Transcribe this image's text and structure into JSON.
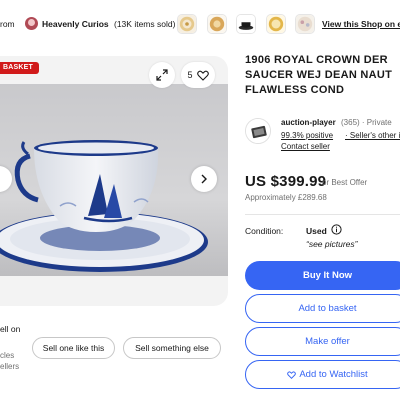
{
  "promo": {
    "from_text": "rom",
    "shop_name": "Heavenly Curios",
    "item_count": "(13K items sold)",
    "thumbnails": [
      "gold-plate-thumb",
      "amber-plate-thumb",
      "teacup-thumb",
      "gold-bowl-thumb",
      "floral-plate-thumb"
    ],
    "view_link": "View this Shop on e"
  },
  "gallery": {
    "badge": "BASKET",
    "watch_count": "5",
    "icons": [
      "expand-icon",
      "heart-icon",
      "chevron-right-icon"
    ]
  },
  "sell": {
    "sell_on": "ell on",
    "frag_cycles": "cles",
    "frag_sellers": "ellers",
    "sell_one_like_this": "Sell one like this",
    "sell_something_else": "Sell something else"
  },
  "listing": {
    "title_line1": "1906 ROYAL CROWN DER",
    "title_line2": "SAUCER WEJ DEAN NAUT",
    "title_line3": "FLAWLESS COND"
  },
  "seller": {
    "name": "auction-player",
    "feedback_count": "(365) · Private",
    "positive": "99.3% positive",
    "other_items": "· Seller's other it",
    "contact": "Contact seller"
  },
  "pricing": {
    "price": "US $399.99",
    "best_offer": "or Best Offer",
    "approx": "Approximately £289.68"
  },
  "condition": {
    "label": "Condition:",
    "value": "Used",
    "note": "“see pictures”"
  },
  "actions": {
    "buy_now": "Buy It Now",
    "add_to_basket": "Add to basket",
    "make_offer": "Make offer",
    "add_to_watchlist": "Add to Watchlist"
  },
  "colors": {
    "accent_blue": "#3665f3",
    "badge_red": "#d11a1a",
    "cobalt": "#1d3a8a"
  }
}
